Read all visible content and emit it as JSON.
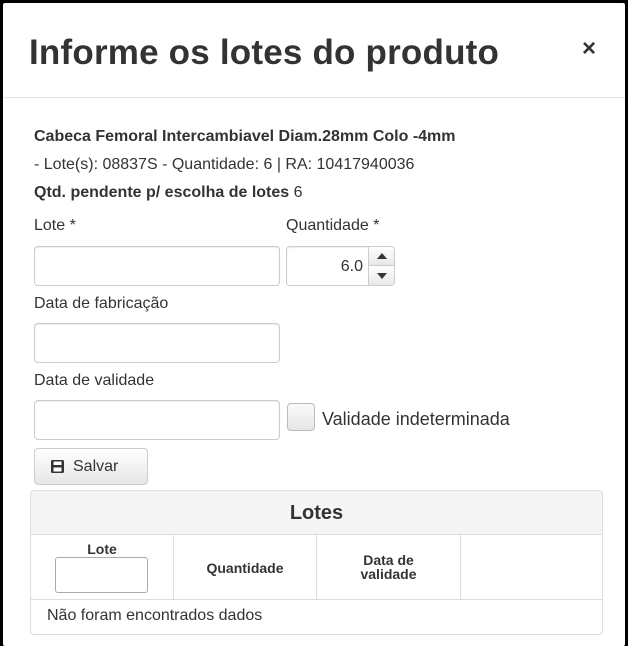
{
  "modal": {
    "title": "Informe os lotes do produto",
    "close_label": "×"
  },
  "product": {
    "name": "Cabeca Femoral Intercambiavel Diam.28mm Colo -4mm",
    "details": "- Lote(s): 08837S - Quantidade: 6 | RA: 10417940036",
    "pending_label": "Qtd. pendente p/ escolha de lotes",
    "pending_value": "6"
  },
  "form": {
    "lote_label": "Lote *",
    "lote_value": "",
    "quantidade_label": "Quantidade *",
    "quantidade_value": "6.0",
    "fabricacao_label": "Data de fabricação",
    "fabricacao_value": "",
    "validade_label": "Data de validade",
    "validade_value": "",
    "indeterminada_label": "Validade indeterminada",
    "save_label": "Salvar"
  },
  "table": {
    "title": "Lotes",
    "columns": [
      "Lote",
      "Quantidade",
      "Data de",
      "validade"
    ],
    "empty_message": "Não foram encontrados dados"
  },
  "icons": {
    "close": "close-icon",
    "save": "floppy-disk-icon",
    "spin_up": "chevron-up-icon",
    "spin_down": "chevron-down-icon"
  }
}
